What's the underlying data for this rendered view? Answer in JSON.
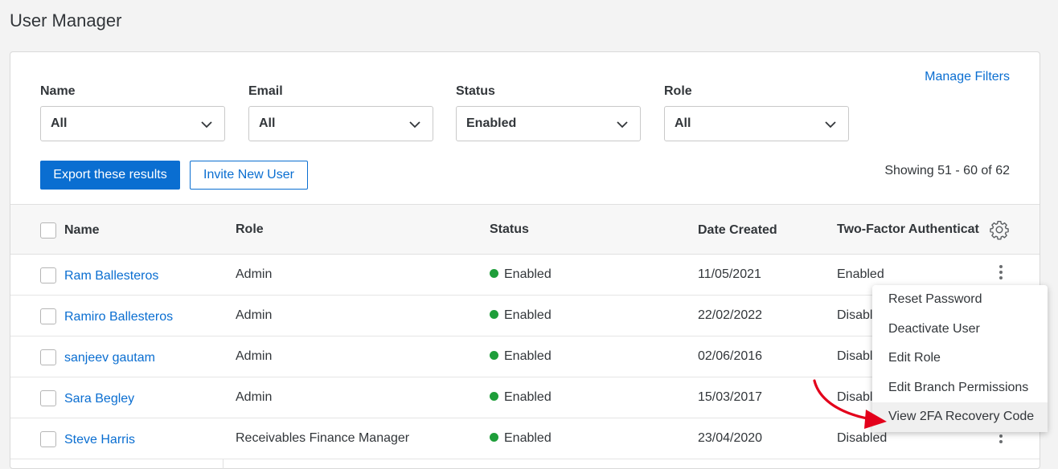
{
  "page": {
    "title": "User Manager"
  },
  "filters": {
    "manage_label": "Manage Filters",
    "items": [
      {
        "label": "Name",
        "value": "All"
      },
      {
        "label": "Email",
        "value": "All"
      },
      {
        "label": "Status",
        "value": "Enabled"
      },
      {
        "label": "Role",
        "value": "All"
      }
    ]
  },
  "actions": {
    "export_label": "Export these results",
    "invite_label": "Invite New User"
  },
  "pagination": {
    "text": "Showing 51 - 60 of 62"
  },
  "table": {
    "columns": [
      "Name",
      "Role",
      "Status",
      "Date Created",
      "Two-Factor Authenticat"
    ],
    "rows": [
      {
        "name": "Ram Ballesteros",
        "role": "Admin",
        "status": "Enabled",
        "date": "11/05/2021",
        "twofa": "Enabled"
      },
      {
        "name": "Ramiro Ballesteros",
        "role": "Admin",
        "status": "Enabled",
        "date": "22/02/2022",
        "twofa": "Disabled"
      },
      {
        "name": "sanjeev gautam",
        "role": "Admin",
        "status": "Enabled",
        "date": "02/06/2016",
        "twofa": "Disabled"
      },
      {
        "name": "Sara Begley",
        "role": "Admin",
        "status": "Enabled",
        "date": "15/03/2017",
        "twofa": "Disabled"
      },
      {
        "name": "Steve Harris",
        "role": "Receivables Finance Manager",
        "status": "Enabled",
        "date": "23/04/2020",
        "twofa": "Disabled"
      }
    ]
  },
  "context_menu": {
    "items": [
      "Reset Password",
      "Deactivate User",
      "Edit Role",
      "Edit Branch Permissions",
      "View 2FA Recovery Code"
    ]
  },
  "colors": {
    "accent": "#0a6ed1",
    "status_enabled": "#1e9e3a",
    "annotation_arrow": "#e3001b"
  },
  "icons": [
    "chevron-down-icon",
    "gear-icon",
    "kebab-icon",
    "checkbox",
    "status-dot",
    "red-arrow-annotation"
  ]
}
